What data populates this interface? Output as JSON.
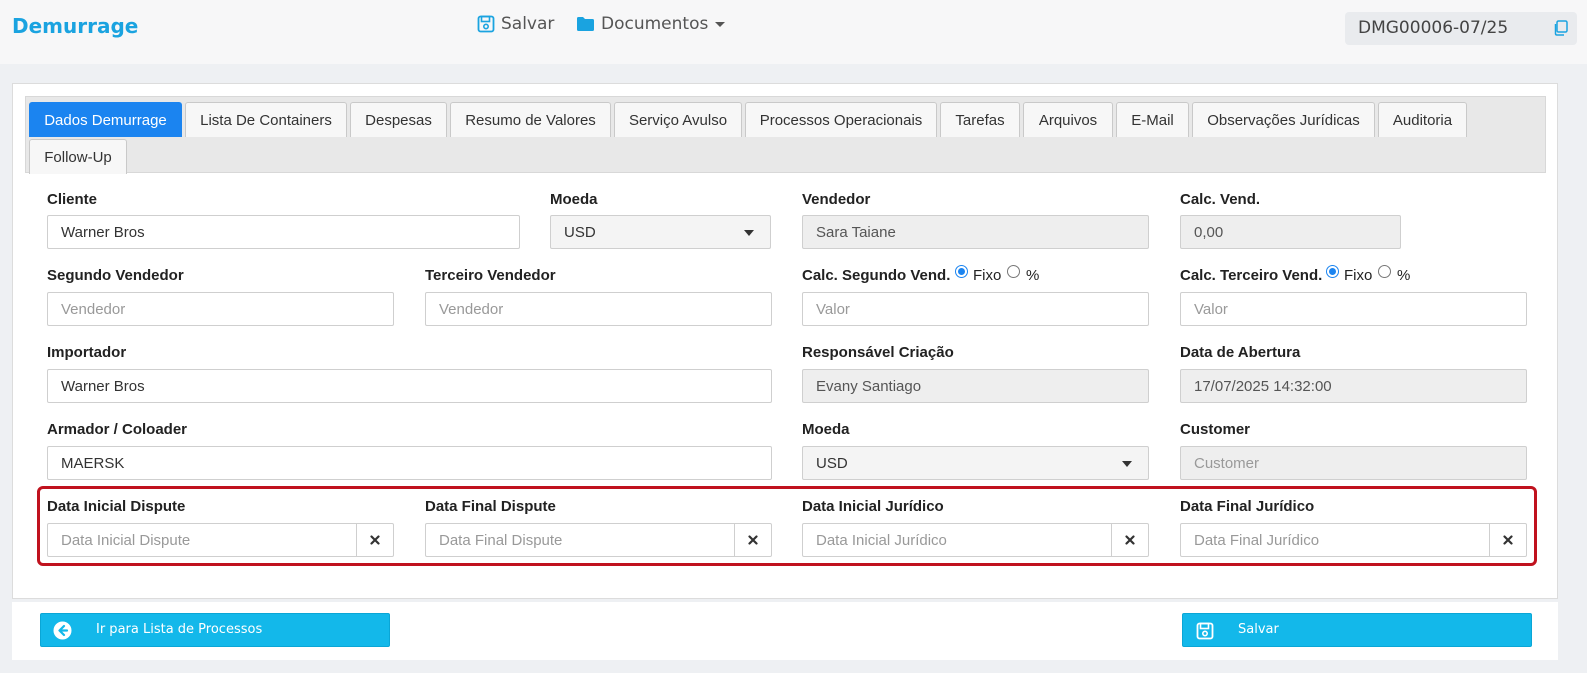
{
  "app": {
    "title": "Demurrage",
    "brand_color": "#1aa3e0"
  },
  "toolbar": {
    "save_label": "Salvar",
    "documents_label": "Documentos",
    "process_code": "DMG00006-07/25"
  },
  "tabs": [
    {
      "label": "Dados Demurrage",
      "active": true
    },
    {
      "label": "Lista De Containers"
    },
    {
      "label": "Despesas"
    },
    {
      "label": "Resumo de Valores"
    },
    {
      "label": "Serviço Avulso"
    },
    {
      "label": "Processos Operacionais"
    },
    {
      "label": "Tarefas"
    },
    {
      "label": "Arquivos"
    },
    {
      "label": "E-Mail"
    },
    {
      "label": "Observações Jurídicas"
    },
    {
      "label": "Auditoria"
    },
    {
      "label": "Follow-Up"
    }
  ],
  "form": {
    "cliente": {
      "label": "Cliente",
      "value": "Warner Bros"
    },
    "moeda1": {
      "label": "Moeda",
      "value": "USD"
    },
    "vendedor": {
      "label": "Vendedor",
      "value": "Sara Taiane"
    },
    "calc_vend": {
      "label": "Calc. Vend.",
      "value": "0,00"
    },
    "segundo_vendedor": {
      "label": "Segundo Vendedor",
      "placeholder": "Vendedor"
    },
    "terceiro_vendedor": {
      "label": "Terceiro Vendedor",
      "placeholder": "Vendedor"
    },
    "calc_segundo": {
      "label": "Calc. Segundo Vend.",
      "opt_fixo": "Fixo",
      "opt_pct": "%",
      "placeholder": "Valor"
    },
    "calc_terceiro": {
      "label": "Calc. Terceiro Vend.",
      "opt_fixo": "Fixo",
      "opt_pct": "%",
      "placeholder": "Valor"
    },
    "importador": {
      "label": "Importador",
      "value": "Warner Bros"
    },
    "responsavel": {
      "label": "Responsável Criação",
      "value": "Evany Santiago"
    },
    "data_abertura": {
      "label": "Data de Abertura",
      "value": "17/07/2025 14:32:00"
    },
    "armador": {
      "label": "Armador / Coloader",
      "value": "MAERSK"
    },
    "moeda2": {
      "label": "Moeda",
      "value": "USD"
    },
    "customer": {
      "label": "Customer",
      "placeholder": "Customer"
    },
    "data_ini_dispute": {
      "label": "Data Inicial Dispute",
      "placeholder": "Data Inicial Dispute"
    },
    "data_fim_dispute": {
      "label": "Data Final Dispute",
      "placeholder": "Data Final Dispute"
    },
    "data_ini_juridico": {
      "label": "Data Inicial Jurídico",
      "placeholder": "Data Inicial Jurídico"
    },
    "data_fim_juridico": {
      "label": "Data Final Jurídico",
      "placeholder": "Data Final Jurídico"
    }
  },
  "footer": {
    "back_label": "Ir para Lista de Processos",
    "save_label": "Salvar",
    "button_color": "#13b8ea"
  },
  "colors": {
    "active_tab": "#1b84f0",
    "highlight": "#c0121e"
  }
}
